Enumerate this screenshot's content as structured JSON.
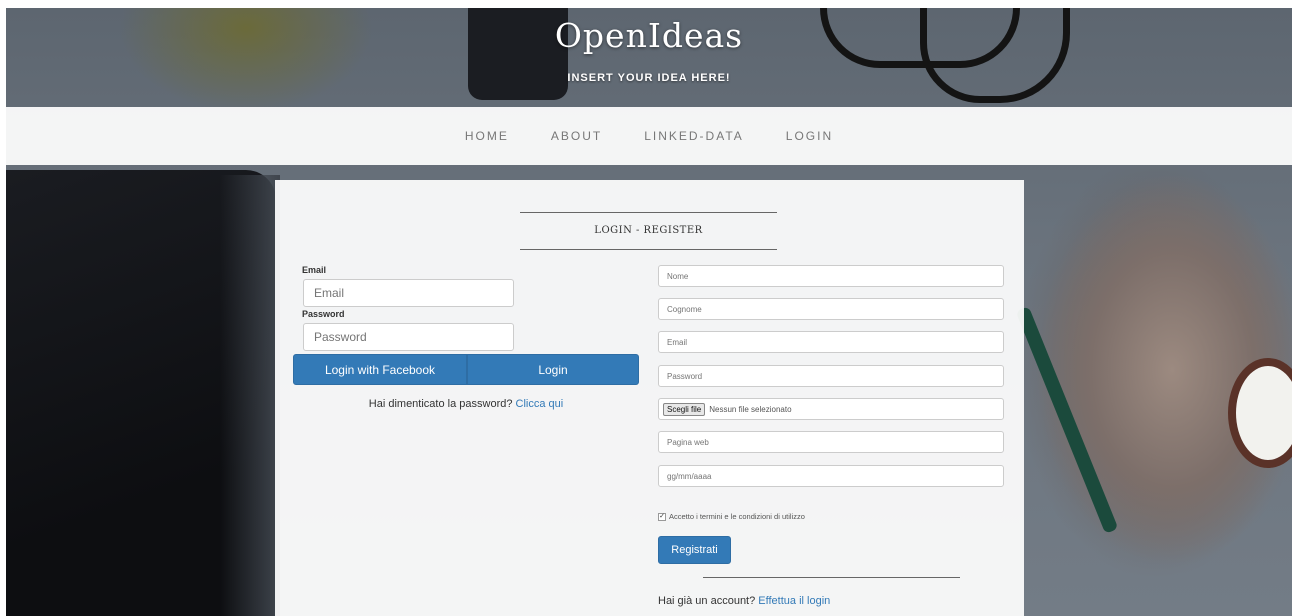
{
  "header": {
    "logo": "OpenIdeas",
    "tagline": "INSERT YOUR IDEA HERE!"
  },
  "nav": {
    "items": [
      {
        "label": "HOME"
      },
      {
        "label": "ABOUT"
      },
      {
        "label": "LINKED-DATA"
      },
      {
        "label": "LOGIN"
      }
    ]
  },
  "section_title": "LOGIN - REGISTER",
  "login": {
    "email_label": "Email",
    "email_placeholder": "Email",
    "password_label": "Password",
    "password_placeholder": "Password",
    "facebook_button": "Login with Facebook",
    "login_button": "Login",
    "forgot_text": "Hai dimenticato la password?",
    "forgot_link": "Clicca qui"
  },
  "register": {
    "nome_placeholder": "Nome",
    "cognome_placeholder": "Cognome",
    "email_placeholder": "Email",
    "password_placeholder": "Password",
    "file_button": "Scegli file",
    "file_status": "Nessun file selezionato",
    "web_placeholder": "Pagina web",
    "date_placeholder": "gg/mm/aaaa",
    "terms_label": "Accetto i termini e le condizioni di utilizzo",
    "terms_checked": true,
    "submit_button": "Registrati",
    "have_account_text": "Hai già un account?",
    "have_account_link": "Effettua il login"
  },
  "colors": {
    "primary": "#337ab7",
    "nav_text": "#777777"
  }
}
